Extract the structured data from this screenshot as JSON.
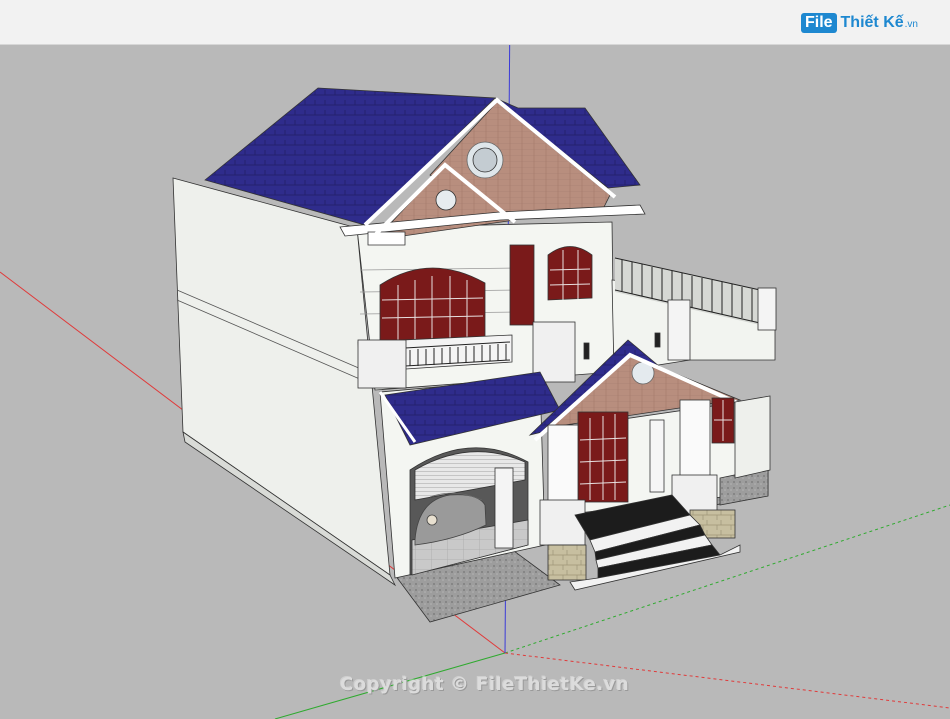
{
  "watermark": {
    "logo_file": "File",
    "logo_rest": "Thiết Kế",
    "logo_tld": ".vn",
    "copyright": "Copyright © FileThietKe.vn"
  },
  "colors": {
    "viewport_bg": "#b9b9b9",
    "roof": "#2d2b86",
    "wall": "#f3f5f2",
    "brick": "#b78c7c",
    "frame": "#6a1414",
    "axis_red": "#e03a3a",
    "axis_green": "#2faa2f",
    "axis_blue": "#3b3bd8"
  },
  "scene": {
    "description_icon": "house-3d-model"
  }
}
